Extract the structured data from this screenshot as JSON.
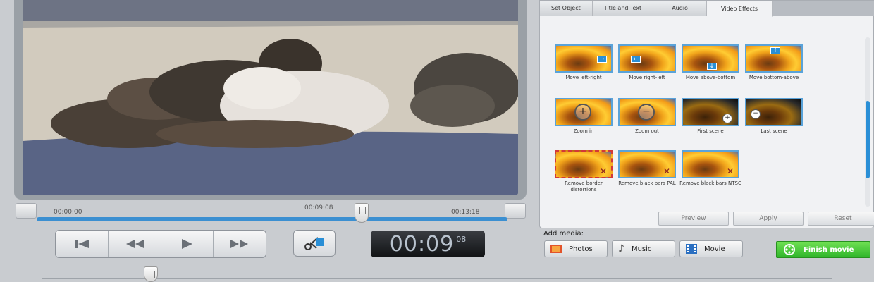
{
  "player": {
    "time_start": "00:00:00",
    "time_current": "00:09:08",
    "time_end": "00:13:18",
    "display_main": "00:09",
    "display_frames": "08",
    "progress_fraction": 0.69
  },
  "tabs": [
    {
      "label": "Set Object",
      "active": false
    },
    {
      "label": "Title and Text",
      "active": false
    },
    {
      "label": "Audio",
      "active": false
    },
    {
      "label": "Video Effects",
      "active": true
    }
  ],
  "effects": [
    {
      "label": "Move left-right",
      "icon": "arrow-right-icon"
    },
    {
      "label": "Move right-left",
      "icon": "arrow-left-icon"
    },
    {
      "label": "Move above-bottom",
      "icon": "arrow-down-icon"
    },
    {
      "label": "Move bottom-above",
      "icon": "arrow-up-icon"
    },
    {
      "label": "Zoom in",
      "icon": "zoom-in-icon"
    },
    {
      "label": "Zoom out",
      "icon": "zoom-out-icon"
    },
    {
      "label": "First scene",
      "icon": "zoom-in-icon"
    },
    {
      "label": "Last scene",
      "icon": "zoom-out-icon"
    },
    {
      "label": "Remove border distortions",
      "icon": "x-icon"
    },
    {
      "label": "Remove black bars PAL",
      "icon": "x-icon"
    },
    {
      "label": "Remove black bars NTSC",
      "icon": "x-icon"
    }
  ],
  "panel_buttons": {
    "preview": "Preview",
    "apply": "Apply",
    "reset": "Reset"
  },
  "add_media": {
    "label": "Add media:",
    "photos": "Photos",
    "music": "Music",
    "movie": "Movie"
  },
  "finish": {
    "label": "Finish movie"
  },
  "colors": {
    "accent": "#2a8fd6",
    "finish": "#3fc233",
    "display_bg": "#1c1e21"
  }
}
